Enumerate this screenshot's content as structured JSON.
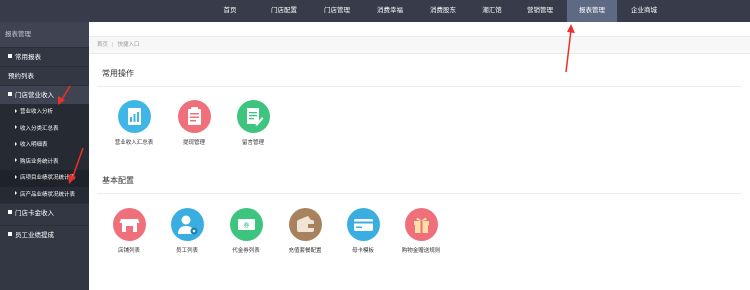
{
  "topnav": {
    "items": [
      {
        "label": "首页",
        "active": false
      },
      {
        "label": "门店配置",
        "active": false
      },
      {
        "label": "门店管理",
        "active": false
      },
      {
        "label": "消费幸福",
        "active": false
      },
      {
        "label": "消费股东",
        "active": false
      },
      {
        "label": "潮汇馆",
        "active": false
      },
      {
        "label": "营销管理",
        "active": false
      },
      {
        "label": "报表管理",
        "active": true
      },
      {
        "label": "企业商城",
        "active": false
      }
    ]
  },
  "sidebar": {
    "title": "报表管理",
    "items": [
      {
        "label": "常用报表"
      },
      {
        "label": "预约列表"
      },
      {
        "label": "门店营业收入"
      },
      {
        "label": "门店卡金收入"
      },
      {
        "label": "员工业绩提成"
      }
    ],
    "subitems": [
      {
        "label": "营业收入分析"
      },
      {
        "label": "收入分类汇总表"
      },
      {
        "label": "收入明细表"
      },
      {
        "label": "购店业务统计表"
      },
      {
        "label": "店项目业绩状况统计表"
      },
      {
        "label": "店产品业绩状况统计表"
      }
    ]
  },
  "breadcrumb": {
    "home": "首页",
    "current": "快捷入口"
  },
  "sections": {
    "common": {
      "title": "常用操作",
      "tiles": [
        {
          "label": "营业收入汇总表",
          "color": "#3fb6e6",
          "icon": "report-chart-icon"
        },
        {
          "label": "提现管理",
          "color": "#ef6f7a",
          "icon": "clipboard-icon"
        },
        {
          "label": "留言管理",
          "color": "#3dc47e",
          "icon": "note-edit-icon"
        }
      ]
    },
    "basic": {
      "title": "基本配置",
      "tiles": [
        {
          "label": "店铺列表",
          "color": "#ef6f7a",
          "icon": "store-icon"
        },
        {
          "label": "员工列表",
          "color": "#3aaee0",
          "icon": "user-settings-icon"
        },
        {
          "label": "代金券列表",
          "color": "#3dc47e",
          "icon": "voucher-icon"
        },
        {
          "label": "充值套餐配置",
          "color": "#a8825f",
          "icon": "wallet-icon"
        },
        {
          "label": "母卡模板",
          "color": "#3aaee0",
          "icon": "card-template-icon"
        },
        {
          "label": "购物金赠送规则",
          "color": "#ef6f7a",
          "icon": "gift-icon"
        }
      ]
    }
  }
}
